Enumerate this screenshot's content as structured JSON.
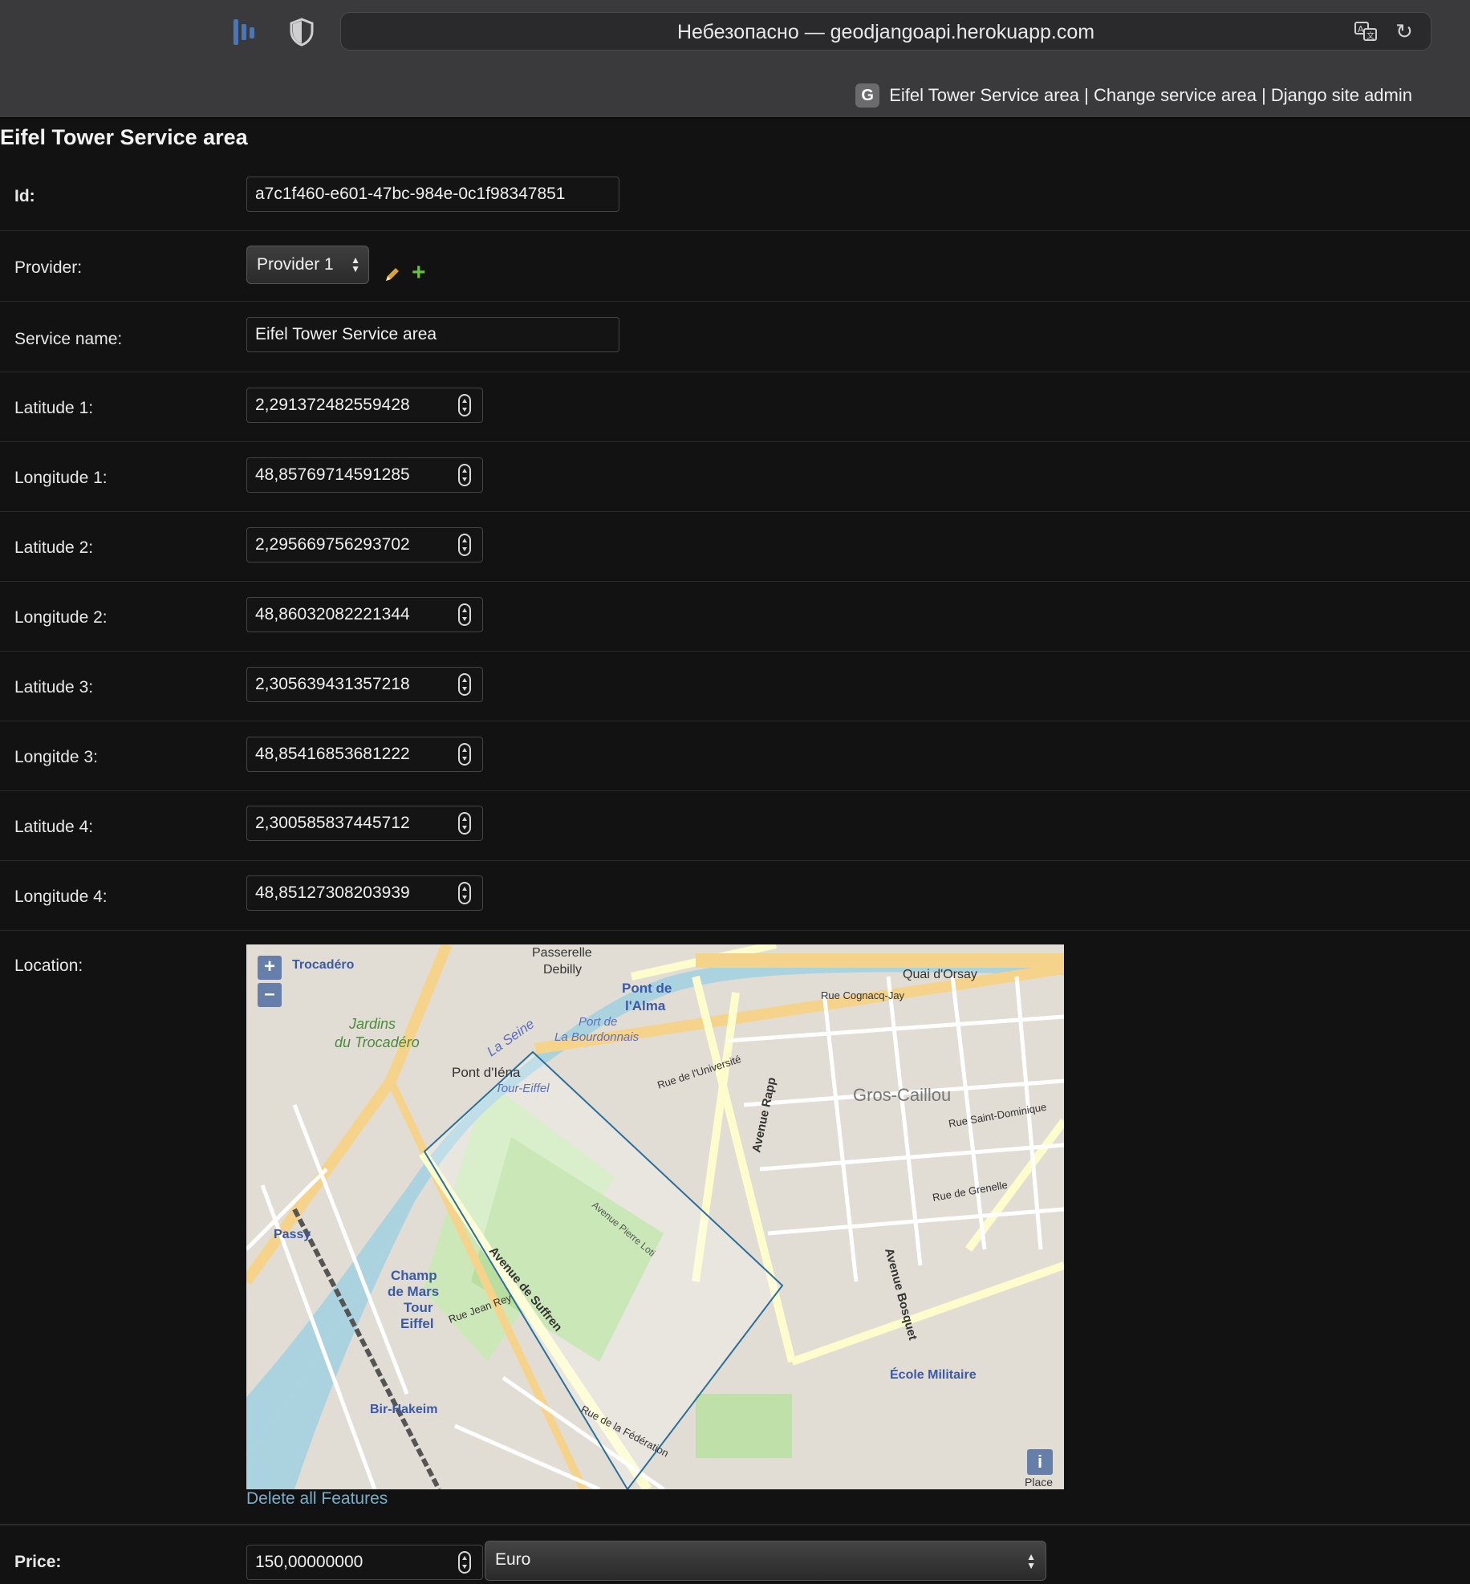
{
  "browser": {
    "url_text": "Небезопасно — geodjangoapi.herokuapp.com",
    "tab_favicon": "G",
    "tab_title": "Eifel Tower Service area | Change service area | Django site admin",
    "icons": [
      "extension-icon",
      "shield-icon",
      "translate-icon",
      "reload-icon"
    ]
  },
  "page": {
    "title": "Eifel Tower Service area"
  },
  "form": {
    "id": {
      "label": "Id:",
      "value": "a7c1f460-e601-47bc-984e-0c1f98347851"
    },
    "provider": {
      "label": "Provider:",
      "selected": "Provider 1",
      "edit_icon": "pencil-icon",
      "add_icon": "plus-icon"
    },
    "service_name": {
      "label": "Service name:",
      "value": "Eifel Tower Service area"
    },
    "lat1": {
      "label": "Latitude 1:",
      "value": "2,291372482559428"
    },
    "lon1": {
      "label": "Longitude 1:",
      "value": "48,85769714591285"
    },
    "lat2": {
      "label": "Latitude 2:",
      "value": "2,295669756293702"
    },
    "lon2": {
      "label": "Longitude 2:",
      "value": "48,86032082221344"
    },
    "lat3": {
      "label": "Latitude 3:",
      "value": "2,305639431357218"
    },
    "lon3": {
      "label": "Longitde 3:",
      "value": "48,85416853681222"
    },
    "lat4": {
      "label": "Latitude 4:",
      "value": "2,300585837445712"
    },
    "lon4": {
      "label": "Longitude 4:",
      "value": "48,85127308203939"
    },
    "location": {
      "label": "Location:",
      "zoom_in": "+",
      "zoom_out": "–",
      "info": "i",
      "delete_link": "Delete all Features",
      "map_labels": {
        "trocadero": "Trocadéro",
        "jardins": "Jardins",
        "du_trocadero": "du Trocadéro",
        "passerelle": "Passerelle",
        "debilly": "Debilly",
        "alma": "l'Alma",
        "pont_de": "Pont de",
        "quai_orsay": "Quai d'Orsay",
        "port_de": "Port de",
        "la_bourdonnais": "La Bourdonnais",
        "pont_iena": "Pont d'Iéna",
        "tour_eiffel_stop": "Tour-Eiffel",
        "seine": "La Seine",
        "gros_caillou": "Gros-Caillou",
        "avenue_rapp": "Avenue Rapp",
        "passy": "Passy",
        "champ": "Champ",
        "de_mars": "de Mars",
        "tour": "Tour",
        "eiffel": "Eiffel",
        "bir_hakeim": "Bir-Hakeim",
        "ecole_militaire": "École Militaire",
        "avenue_bosquet": "Avenue Bosquet",
        "avenue_suffren": "Avenue de Suffren",
        "rue_universite": "Rue de l'Université",
        "rue_grenelle": "Rue de Grenelle",
        "rue_st_dominique": "Rue Saint-Dominique",
        "rue_federation": "Rue de la Fédération",
        "rue_jean_rey": "Rue Jean Rey",
        "avenue_pierre_loti": "Avenue Pierre Loti",
        "quai_cognacq": "Rue Cognacq-Jay",
        "place": "Place"
      }
    },
    "price": {
      "label": "Price:",
      "value": "150,00000000",
      "currency": "Euro"
    }
  },
  "colors": {
    "background": "#121212",
    "chrome": "#3a3a3c",
    "link": "#79aec8",
    "polygon": "#2a6f9a",
    "seine": "#aad3df"
  }
}
